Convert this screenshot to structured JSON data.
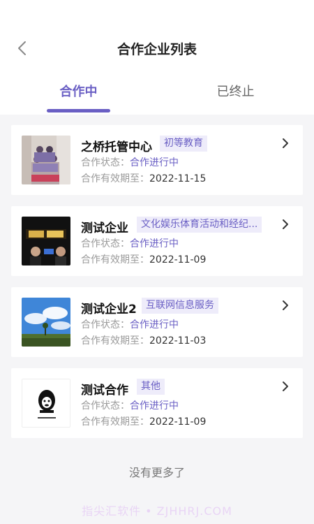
{
  "header": {
    "title": "合作企业列表"
  },
  "tabs": [
    {
      "label": "合作中",
      "active": true
    },
    {
      "label": "已终止",
      "active": false
    }
  ],
  "list": {
    "status_label": "合作状态：",
    "expiry_label": "合作有效期至：",
    "items": [
      {
        "name": "之桥托管中心",
        "tag": "初等教育",
        "status": "合作进行中",
        "expiry": "2022-11-15"
      },
      {
        "name": "测试企业",
        "tag": "文化娱乐体育活动和经纪...",
        "status": "合作进行中",
        "expiry": "2022-11-09"
      },
      {
        "name": "测试企业2",
        "tag": "互联网信息服务",
        "status": "合作进行中",
        "expiry": "2022-11-03"
      },
      {
        "name": "测试合作",
        "tag": "其他",
        "status": "合作进行中",
        "expiry": "2022-11-09"
      }
    ]
  },
  "footer": {
    "no_more": "没有更多了",
    "watermark": "指尖汇软件 • ZJHHRJ.COM"
  },
  "colors": {
    "accent": "#6a5fc4",
    "tag_bg": "#eeecfa",
    "page_bg": "#f5f5f7"
  }
}
